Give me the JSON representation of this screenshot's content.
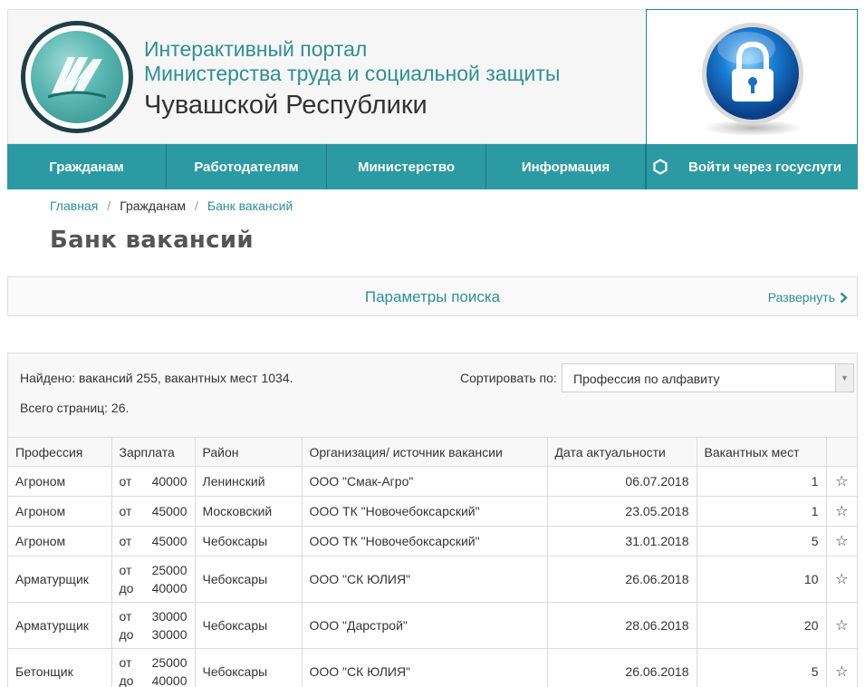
{
  "header": {
    "title_line1": "Интерактивный портал",
    "title_line2": "Министерства труда и социальной защиты",
    "title_line3": "Чувашской Республики"
  },
  "nav": {
    "items": [
      {
        "label": "Гражданам"
      },
      {
        "label": "Работодателям"
      },
      {
        "label": "Министерство"
      },
      {
        "label": "Информация"
      }
    ],
    "login_label": "Войти через госуслуги"
  },
  "breadcrumb": {
    "items": [
      {
        "label": "Главная"
      },
      {
        "label": "Гражданам"
      },
      {
        "label": "Банк вакансий"
      }
    ],
    "separator": "/"
  },
  "page_title": "Банк вакансий",
  "search": {
    "title": "Параметры поиска",
    "expand_label": "Развернуть"
  },
  "results": {
    "found_text": "Найдено: вакансий 255, вакантных мест 1034.",
    "pages_text": "Всего страниц: 26.",
    "sort_label": "Сортировать по:",
    "sort_value": "Профессия по алфавиту"
  },
  "table": {
    "headers": [
      "Профессия",
      "Зарплата",
      "Район",
      "Организация/ источник вакансии",
      "Дата актуальности",
      "Вакантных мест"
    ],
    "rows": [
      {
        "profession": "Агроном",
        "salary_from_label": "от",
        "salary_from": "40000",
        "salary_to_label": "",
        "salary_to": "",
        "district": "Ленинский",
        "organization": "ООО \"Смак-Агро\"",
        "date": "06.07.2018",
        "count": "1"
      },
      {
        "profession": "Агроном",
        "salary_from_label": "от",
        "salary_from": "45000",
        "salary_to_label": "",
        "salary_to": "",
        "district": "Московский",
        "organization": "ООО ТК \"Новочебоксарский\"",
        "date": "23.05.2018",
        "count": "1"
      },
      {
        "profession": "Агроном",
        "salary_from_label": "от",
        "salary_from": "45000",
        "salary_to_label": "",
        "salary_to": "",
        "district": "Чебоксары",
        "organization": "ООО ТК \"Новочебоксарский\"",
        "date": "31.01.2018",
        "count": "5"
      },
      {
        "profession": "Арматурщик",
        "salary_from_label": "от",
        "salary_from": "25000",
        "salary_to_label": "до",
        "salary_to": "40000",
        "district": "Чебоксары",
        "organization": "ООО \"СК ЮЛИЯ\"",
        "date": "26.06.2018",
        "count": "10"
      },
      {
        "profession": "Арматурщик",
        "salary_from_label": "от",
        "salary_from": "30000",
        "salary_to_label": "до",
        "salary_to": "30000",
        "district": "Чебоксары",
        "organization": "ООО \"Дарстрой\"",
        "date": "28.06.2018",
        "count": "20"
      },
      {
        "profession": "Бетонщик",
        "salary_from_label": "от",
        "salary_from": "25000",
        "salary_to_label": "до",
        "salary_to": "40000",
        "district": "Чебоксары",
        "organization": "ООО \"СК ЮЛИЯ\"",
        "date": "26.06.2018",
        "count": "5"
      }
    ],
    "favorite_icon": "star-outline-icon"
  },
  "colors": {
    "accent": "#2b9aa2",
    "link": "#2b8f96"
  }
}
